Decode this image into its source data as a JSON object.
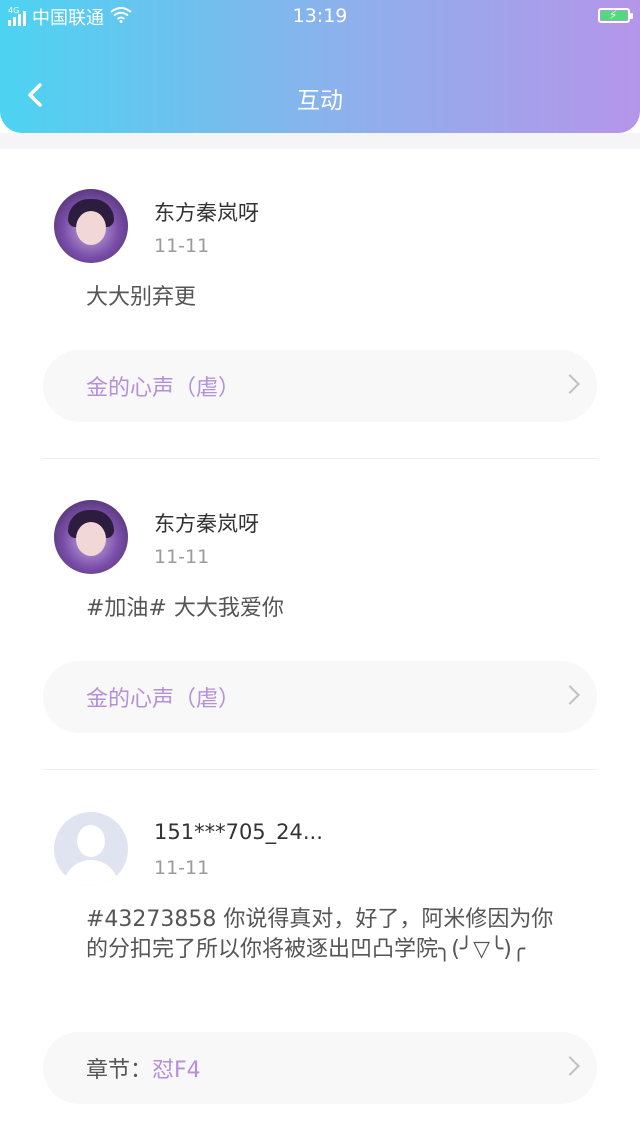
{
  "status_bar": {
    "network": "4G",
    "carrier": "中国联通",
    "time": "13:19"
  },
  "header": {
    "title": "互动",
    "back_icon": "chevron-left-icon"
  },
  "posts": [
    {
      "username": "东方秦岚呀",
      "date": "11-11",
      "content": "大大别弃更",
      "link_text": "金的心声（虐）"
    },
    {
      "username": "东方秦岚呀",
      "date": "11-11",
      "content": "#加油# 大大我爱你",
      "link_text": "金的心声（虐）"
    },
    {
      "username": "151***705_24...",
      "date": "11-11",
      "content": "#43273858 你说得真对，好了，阿米修因为你的分扣完了所以你将被逐出凹凸学院╮(╯▽╰)╭",
      "link_label": "章节：",
      "link_text": "怼F4"
    }
  ],
  "colors": {
    "header_gradient": [
      "#4cd3f1",
      "#b595ea"
    ],
    "accent_purple": "#b390d8"
  }
}
